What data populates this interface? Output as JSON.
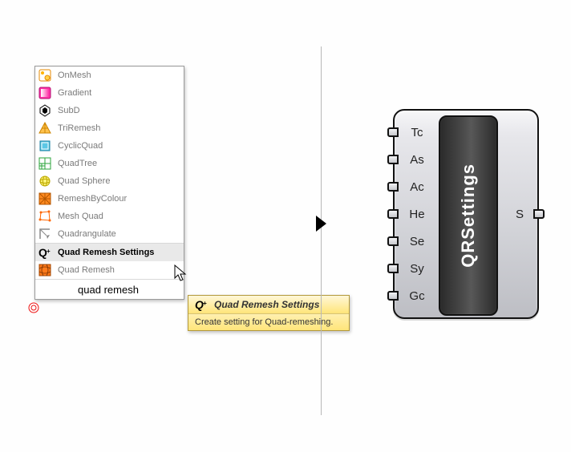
{
  "popup": {
    "items": [
      {
        "label": "OnMesh",
        "icon": "onmesh-icon"
      },
      {
        "label": "Gradient",
        "icon": "gradient-icon"
      },
      {
        "label": "SubD",
        "icon": "subd-icon"
      },
      {
        "label": "TriRemesh",
        "icon": "triremesh-icon"
      },
      {
        "label": "CyclicQuad",
        "icon": "cyclicquad-icon"
      },
      {
        "label": "QuadTree",
        "icon": "quadtree-icon"
      },
      {
        "label": "Quad Sphere",
        "icon": "quadsphere-icon"
      },
      {
        "label": "RemeshByColour",
        "icon": "remeshbycolour-icon"
      },
      {
        "label": "Mesh Quad",
        "icon": "meshquad-icon"
      },
      {
        "label": "Quadrangulate",
        "icon": "quadrangulate-icon"
      },
      {
        "label": "Quad Remesh Settings",
        "icon": "qplus-icon",
        "selected": true,
        "sep": true
      },
      {
        "label": "Quad Remesh",
        "icon": "quadremesh-icon"
      }
    ],
    "search_value": "quad remesh"
  },
  "tooltip": {
    "title": "Quad Remesh Settings",
    "body": "Create setting for Quad-remeshing."
  },
  "component": {
    "label": "QRSettings",
    "inputs": [
      "Tc",
      "As",
      "Ac",
      "He",
      "Se",
      "Sy",
      "Gc"
    ],
    "outputs": [
      "S"
    ]
  }
}
